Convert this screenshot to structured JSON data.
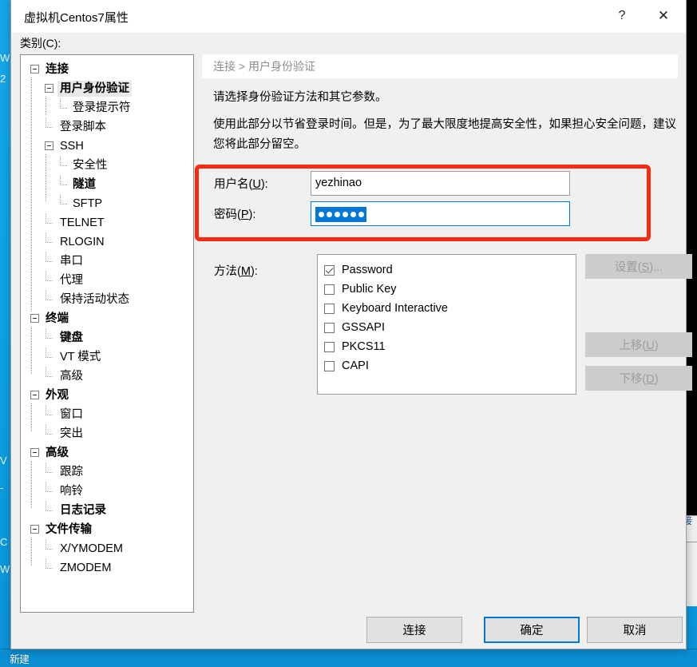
{
  "desktop": {
    "left_text_top": "W\n2",
    "left_text_bottom": "V\n-\n\nC\nW",
    "right_fragment_text": "接",
    "taskbar_label": "新建"
  },
  "dialog": {
    "title": "虚拟机Centos7属性",
    "help_icon": "?",
    "close_icon": "✕",
    "category_label": "类别(C):"
  },
  "tree": {
    "items": [
      {
        "label": "连接",
        "level": 0,
        "bold": true,
        "expander": true,
        "selected": false
      },
      {
        "label": "用户身份验证",
        "level": 1,
        "bold": true,
        "expander": true,
        "selected": true
      },
      {
        "label": "登录提示符",
        "level": 2,
        "bold": false,
        "expander": false,
        "selected": false
      },
      {
        "label": "登录脚本",
        "level": 1,
        "bold": false,
        "expander": false,
        "selected": false
      },
      {
        "label": "SSH",
        "level": 1,
        "bold": false,
        "expander": true,
        "selected": false
      },
      {
        "label": "安全性",
        "level": 2,
        "bold": false,
        "expander": false,
        "selected": false
      },
      {
        "label": "隧道",
        "level": 2,
        "bold": true,
        "expander": false,
        "selected": false
      },
      {
        "label": "SFTP",
        "level": 2,
        "bold": false,
        "expander": false,
        "selected": false
      },
      {
        "label": "TELNET",
        "level": 1,
        "bold": false,
        "expander": false,
        "selected": false
      },
      {
        "label": "RLOGIN",
        "level": 1,
        "bold": false,
        "expander": false,
        "selected": false
      },
      {
        "label": "串口",
        "level": 1,
        "bold": false,
        "expander": false,
        "selected": false
      },
      {
        "label": "代理",
        "level": 1,
        "bold": false,
        "expander": false,
        "selected": false
      },
      {
        "label": "保持活动状态",
        "level": 1,
        "bold": false,
        "expander": false,
        "selected": false
      },
      {
        "label": "终端",
        "level": 0,
        "bold": true,
        "expander": true,
        "selected": false
      },
      {
        "label": "键盘",
        "level": 1,
        "bold": true,
        "expander": false,
        "selected": false
      },
      {
        "label": "VT 模式",
        "level": 1,
        "bold": false,
        "expander": false,
        "selected": false
      },
      {
        "label": "高级",
        "level": 1,
        "bold": false,
        "expander": false,
        "selected": false
      },
      {
        "label": "外观",
        "level": 0,
        "bold": true,
        "expander": true,
        "selected": false
      },
      {
        "label": "窗口",
        "level": 1,
        "bold": false,
        "expander": false,
        "selected": false
      },
      {
        "label": "突出",
        "level": 1,
        "bold": false,
        "expander": false,
        "selected": false
      },
      {
        "label": "高级",
        "level": 0,
        "bold": true,
        "expander": true,
        "selected": false
      },
      {
        "label": "跟踪",
        "level": 1,
        "bold": false,
        "expander": false,
        "selected": false
      },
      {
        "label": "响铃",
        "level": 1,
        "bold": false,
        "expander": false,
        "selected": false
      },
      {
        "label": "日志记录",
        "level": 1,
        "bold": true,
        "expander": false,
        "selected": false
      },
      {
        "label": "文件传输",
        "level": 0,
        "bold": true,
        "expander": true,
        "selected": false
      },
      {
        "label": "X/YMODEM",
        "level": 1,
        "bold": false,
        "expander": false,
        "selected": false
      },
      {
        "label": "ZMODEM",
        "level": 1,
        "bold": false,
        "expander": false,
        "selected": false
      }
    ]
  },
  "content": {
    "breadcrumb": "连接 > 用户身份验证",
    "description_1": "请选择身份验证方法和其它参数。",
    "description_2": "使用此部分以节省登录时间。但是，为了最大限度地提高安全性，如果担心安全问题，建议您将此部分留空。",
    "username": {
      "label_prefix": "用户名(",
      "label_accel": "U",
      "label_suffix": "):",
      "value": "yezhinao",
      "placeholder": ""
    },
    "password": {
      "label_prefix": "密码(",
      "label_accel": "P",
      "label_suffix": "):",
      "masked_char_count": 6,
      "selection_color": "#0078d7"
    },
    "methods_label_prefix": "方法(",
    "methods_label_accel": "M",
    "methods_label_suffix": "):",
    "methods": [
      {
        "label": "Password",
        "checked": true
      },
      {
        "label": "Public Key",
        "checked": false
      },
      {
        "label": "Keyboard Interactive",
        "checked": false
      },
      {
        "label": "GSSAPI",
        "checked": false
      },
      {
        "label": "PKCS11",
        "checked": false
      },
      {
        "label": "CAPI",
        "checked": false
      }
    ],
    "side_buttons": [
      {
        "prefix": "设置(",
        "accel": "S",
        "suffix": ")...",
        "enabled": false
      },
      {
        "prefix": "上移(",
        "accel": "U",
        "suffix": ")",
        "enabled": false
      },
      {
        "prefix": "下移(",
        "accel": "D",
        "suffix": ")",
        "enabled": false
      }
    ]
  },
  "footer": {
    "connect_label": "连接",
    "ok_label": "确定",
    "cancel_label": "取消"
  },
  "annotation": {
    "highlight_color": "#fa2a12",
    "highlight_target": "credentials-group"
  }
}
